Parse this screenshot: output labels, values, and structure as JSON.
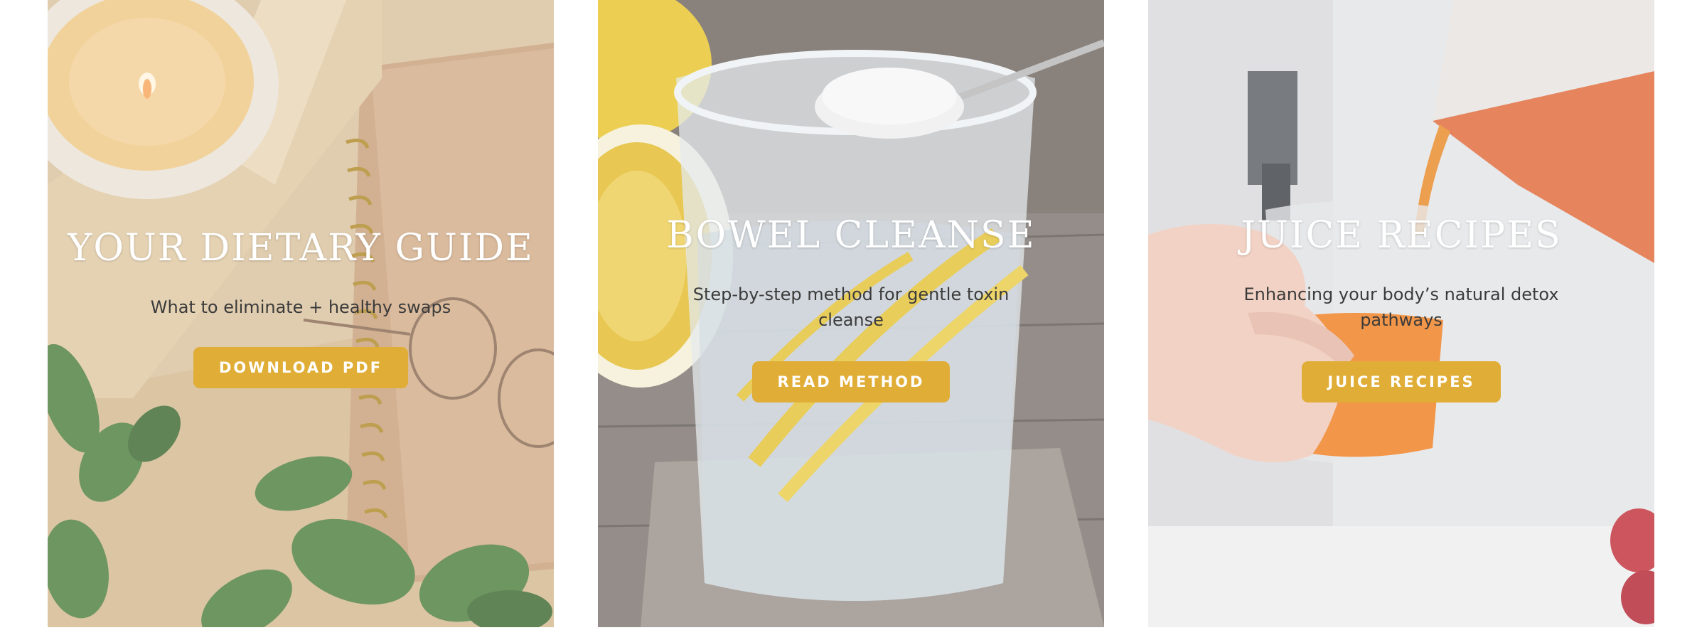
{
  "cards": [
    {
      "title": "YOUR DIETARY GUIDE",
      "subtitle": "What to eliminate + healthy swaps",
      "button_label": "DOWNLOAD PDF"
    },
    {
      "title": "BOWEL CLEANSE",
      "subtitle": "Step-by-step method for gentle toxin cleanse",
      "button_label": "READ METHOD"
    },
    {
      "title": "JUICE RECIPES",
      "subtitle": "Enhancing your body’s natural detox pathways",
      "button_label": "JUICE RECIPES"
    }
  ],
  "colors": {
    "button": "#e0ad37",
    "title": "#ffffff",
    "subtitle": "#3b3b3b"
  }
}
